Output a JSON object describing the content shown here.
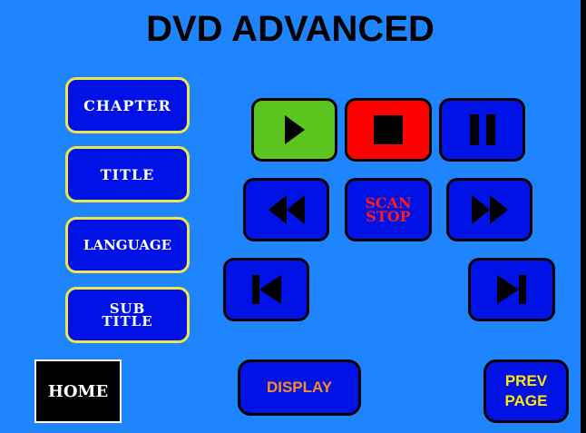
{
  "title": "DVD ADVANCED",
  "menu": {
    "chapter": "CHAPTER",
    "title": "TITLE",
    "language": "LANGUAGE",
    "subtitle_line1": "SUB",
    "subtitle_line2": "TITLE"
  },
  "transport": {
    "scan_line1": "SCAN",
    "scan_line2": "STOP"
  },
  "bottom": {
    "home": "HOME",
    "display": "DISPLAY",
    "prev_line1": "PREV",
    "prev_line2": "PAGE"
  },
  "icons": {
    "play": "play-icon",
    "stop": "stop-icon",
    "pause": "pause-icon",
    "rewind": "rewind-icon",
    "fast_forward": "fast-forward-icon",
    "skip_previous": "skip-previous-icon",
    "skip_next": "skip-next-icon"
  },
  "colors": {
    "background": "#1F85FF",
    "button_blue": "#0012E6",
    "play_green": "#5CC41F",
    "stop_red": "#FF0000",
    "menu_border": "#F0E64A",
    "display_text": "#FF8A1F",
    "prev_text": "#FFE600",
    "scan_text": "#FF1A1A"
  }
}
